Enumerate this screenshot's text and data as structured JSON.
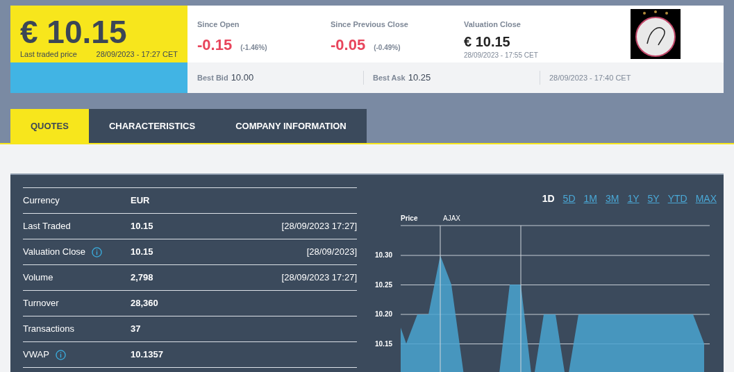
{
  "header": {
    "price": "€ 10.15",
    "price_label": "Last traded price",
    "price_time": "28/09/2023 - 17:27  CET",
    "stats": [
      {
        "kind": "change",
        "label": "Since Open",
        "value": "-0.15",
        "change": "(-1.46%)"
      },
      {
        "kind": "change",
        "label": "Since Previous Close",
        "value": "-0.05",
        "change": "(-0.49%)"
      },
      {
        "kind": "valuation",
        "label": "Valuation Close",
        "value": "€ 10.15",
        "time": "28/09/2023 - 17:55  CET"
      }
    ],
    "best_bid": {
      "label": "Best Bid",
      "value": "10.00"
    },
    "best_ask": {
      "label": "Best Ask",
      "value": "10.25"
    },
    "quote_time": "28/09/2023 - 17:40  CET"
  },
  "tabs": [
    {
      "label": "QUOTES",
      "selected": true
    },
    {
      "label": "CHARACTERISTICS",
      "selected": false
    },
    {
      "label": "COMPANY INFORMATION",
      "selected": false
    }
  ],
  "quotes": [
    {
      "label": "Currency",
      "value": "EUR",
      "info": false
    },
    {
      "label": "Last Traded",
      "value": "10.15",
      "time": "[28/09/2023 17:27]",
      "info": false
    },
    {
      "label": "Valuation Close",
      "value": "10.15",
      "time": "[28/09/2023]",
      "info": true
    },
    {
      "label": "Volume",
      "value": "2,798",
      "time": "[28/09/2023 17:27]",
      "info": false
    },
    {
      "label": "Turnover",
      "value": "28,360",
      "info": false
    },
    {
      "label": "Transactions",
      "value": "37",
      "info": false
    },
    {
      "label": "VWAP",
      "value": "10.1357",
      "info": true
    }
  ],
  "periods": [
    {
      "label": "1D",
      "selected": true
    },
    {
      "label": "5D",
      "selected": false
    },
    {
      "label": "1M",
      "selected": false
    },
    {
      "label": "3M",
      "selected": false
    },
    {
      "label": "1Y",
      "selected": false
    },
    {
      "label": "5Y",
      "selected": false
    },
    {
      "label": "YTD",
      "selected": false
    },
    {
      "label": "MAX",
      "selected": false
    }
  ],
  "chart": {
    "axis_title": "Price",
    "marker_label": "AJAX",
    "y_labels": [
      "10.30",
      "10.25",
      "10.20",
      "10.15"
    ]
  }
}
